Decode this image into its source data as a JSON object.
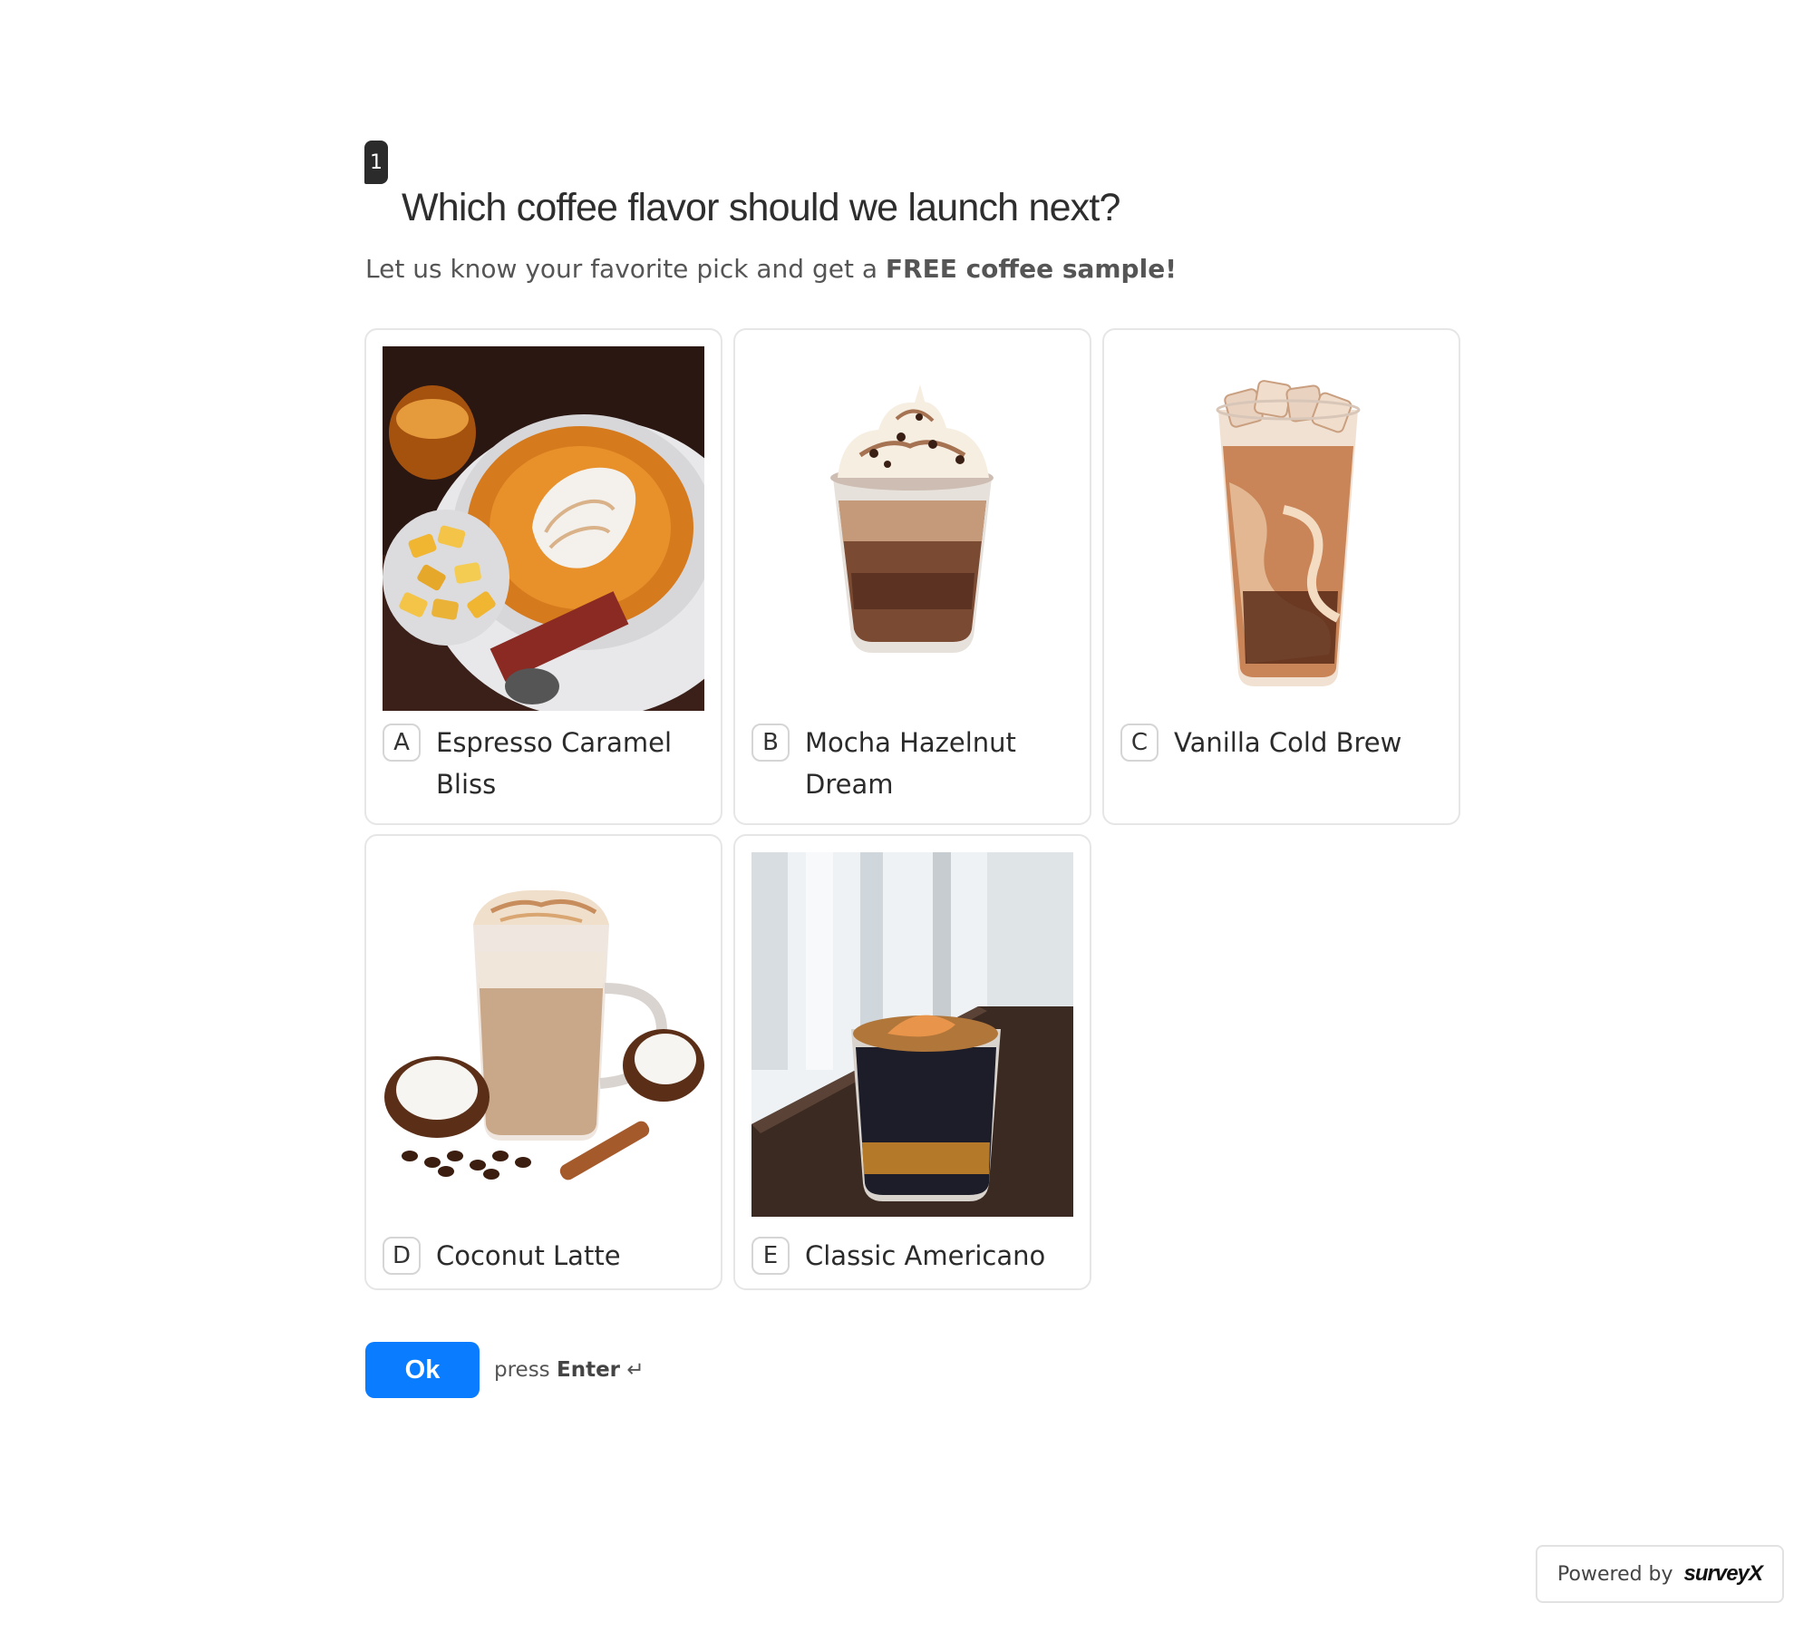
{
  "question": {
    "number": "1",
    "title": "Which coffee flavor should we launch next?",
    "subtitle_prefix": "Let us know your favorite pick and get a ",
    "subtitle_bold": "FREE coffee sample!"
  },
  "options": [
    {
      "key": "A",
      "label": "Espresso Caramel Bliss"
    },
    {
      "key": "B",
      "label": "Mocha Hazelnut Dream"
    },
    {
      "key": "C",
      "label": "Vanilla Cold Brew"
    },
    {
      "key": "D",
      "label": "Coconut Latte"
    },
    {
      "key": "E",
      "label": "Classic Americano"
    }
  ],
  "footer": {
    "ok_label": "Ok",
    "hint_prefix": "press ",
    "hint_key": "Enter",
    "hint_icon": "↵",
    "powered_prefix": "Powered by",
    "powered_brand": "surveyX"
  },
  "colors": {
    "accent": "#0a7cff",
    "card_border": "#e6e6e6"
  }
}
